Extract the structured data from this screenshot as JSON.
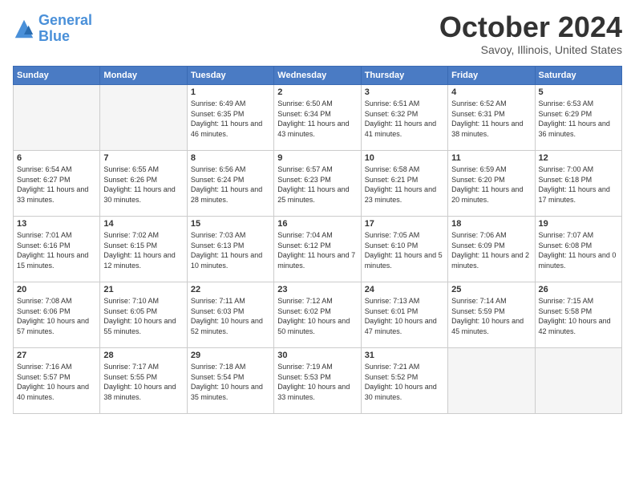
{
  "logo": {
    "line1": "General",
    "line2": "Blue"
  },
  "title": "October 2024",
  "location": "Savoy, Illinois, United States",
  "days_of_week": [
    "Sunday",
    "Monday",
    "Tuesday",
    "Wednesday",
    "Thursday",
    "Friday",
    "Saturday"
  ],
  "weeks": [
    [
      {
        "day": "",
        "info": ""
      },
      {
        "day": "",
        "info": ""
      },
      {
        "day": "1",
        "info": "Sunrise: 6:49 AM\nSunset: 6:35 PM\nDaylight: 11 hours and 46 minutes."
      },
      {
        "day": "2",
        "info": "Sunrise: 6:50 AM\nSunset: 6:34 PM\nDaylight: 11 hours and 43 minutes."
      },
      {
        "day": "3",
        "info": "Sunrise: 6:51 AM\nSunset: 6:32 PM\nDaylight: 11 hours and 41 minutes."
      },
      {
        "day": "4",
        "info": "Sunrise: 6:52 AM\nSunset: 6:31 PM\nDaylight: 11 hours and 38 minutes."
      },
      {
        "day": "5",
        "info": "Sunrise: 6:53 AM\nSunset: 6:29 PM\nDaylight: 11 hours and 36 minutes."
      }
    ],
    [
      {
        "day": "6",
        "info": "Sunrise: 6:54 AM\nSunset: 6:27 PM\nDaylight: 11 hours and 33 minutes."
      },
      {
        "day": "7",
        "info": "Sunrise: 6:55 AM\nSunset: 6:26 PM\nDaylight: 11 hours and 30 minutes."
      },
      {
        "day": "8",
        "info": "Sunrise: 6:56 AM\nSunset: 6:24 PM\nDaylight: 11 hours and 28 minutes."
      },
      {
        "day": "9",
        "info": "Sunrise: 6:57 AM\nSunset: 6:23 PM\nDaylight: 11 hours and 25 minutes."
      },
      {
        "day": "10",
        "info": "Sunrise: 6:58 AM\nSunset: 6:21 PM\nDaylight: 11 hours and 23 minutes."
      },
      {
        "day": "11",
        "info": "Sunrise: 6:59 AM\nSunset: 6:20 PM\nDaylight: 11 hours and 20 minutes."
      },
      {
        "day": "12",
        "info": "Sunrise: 7:00 AM\nSunset: 6:18 PM\nDaylight: 11 hours and 17 minutes."
      }
    ],
    [
      {
        "day": "13",
        "info": "Sunrise: 7:01 AM\nSunset: 6:16 PM\nDaylight: 11 hours and 15 minutes."
      },
      {
        "day": "14",
        "info": "Sunrise: 7:02 AM\nSunset: 6:15 PM\nDaylight: 11 hours and 12 minutes."
      },
      {
        "day": "15",
        "info": "Sunrise: 7:03 AM\nSunset: 6:13 PM\nDaylight: 11 hours and 10 minutes."
      },
      {
        "day": "16",
        "info": "Sunrise: 7:04 AM\nSunset: 6:12 PM\nDaylight: 11 hours and 7 minutes."
      },
      {
        "day": "17",
        "info": "Sunrise: 7:05 AM\nSunset: 6:10 PM\nDaylight: 11 hours and 5 minutes."
      },
      {
        "day": "18",
        "info": "Sunrise: 7:06 AM\nSunset: 6:09 PM\nDaylight: 11 hours and 2 minutes."
      },
      {
        "day": "19",
        "info": "Sunrise: 7:07 AM\nSunset: 6:08 PM\nDaylight: 11 hours and 0 minutes."
      }
    ],
    [
      {
        "day": "20",
        "info": "Sunrise: 7:08 AM\nSunset: 6:06 PM\nDaylight: 10 hours and 57 minutes."
      },
      {
        "day": "21",
        "info": "Sunrise: 7:10 AM\nSunset: 6:05 PM\nDaylight: 10 hours and 55 minutes."
      },
      {
        "day": "22",
        "info": "Sunrise: 7:11 AM\nSunset: 6:03 PM\nDaylight: 10 hours and 52 minutes."
      },
      {
        "day": "23",
        "info": "Sunrise: 7:12 AM\nSunset: 6:02 PM\nDaylight: 10 hours and 50 minutes."
      },
      {
        "day": "24",
        "info": "Sunrise: 7:13 AM\nSunset: 6:01 PM\nDaylight: 10 hours and 47 minutes."
      },
      {
        "day": "25",
        "info": "Sunrise: 7:14 AM\nSunset: 5:59 PM\nDaylight: 10 hours and 45 minutes."
      },
      {
        "day": "26",
        "info": "Sunrise: 7:15 AM\nSunset: 5:58 PM\nDaylight: 10 hours and 42 minutes."
      }
    ],
    [
      {
        "day": "27",
        "info": "Sunrise: 7:16 AM\nSunset: 5:57 PM\nDaylight: 10 hours and 40 minutes."
      },
      {
        "day": "28",
        "info": "Sunrise: 7:17 AM\nSunset: 5:55 PM\nDaylight: 10 hours and 38 minutes."
      },
      {
        "day": "29",
        "info": "Sunrise: 7:18 AM\nSunset: 5:54 PM\nDaylight: 10 hours and 35 minutes."
      },
      {
        "day": "30",
        "info": "Sunrise: 7:19 AM\nSunset: 5:53 PM\nDaylight: 10 hours and 33 minutes."
      },
      {
        "day": "31",
        "info": "Sunrise: 7:21 AM\nSunset: 5:52 PM\nDaylight: 10 hours and 30 minutes."
      },
      {
        "day": "",
        "info": ""
      },
      {
        "day": "",
        "info": ""
      }
    ]
  ]
}
